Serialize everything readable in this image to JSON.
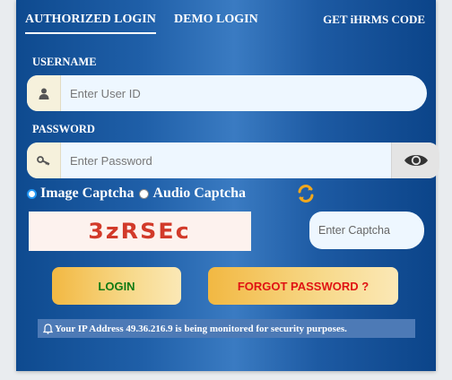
{
  "tabs": {
    "authorized": "AUTHORIZED LOGIN",
    "demo": "DEMO LOGIN",
    "code": "GET iHRMS CODE"
  },
  "username": {
    "label": "USERNAME",
    "placeholder": "Enter User ID",
    "icon": "user-icon"
  },
  "password": {
    "label": "PASSWORD",
    "placeholder": "Enter Password",
    "icon": "key-icon",
    "toggle_icon": "eye-icon"
  },
  "captcha": {
    "options": [
      "Image Captcha",
      "Audio Captcha"
    ],
    "selected": "Image Captcha",
    "text": "3zRSEc",
    "placeholder": "Enter Captcha",
    "refresh_icon": "refresh-icon"
  },
  "buttons": {
    "login": "LOGIN",
    "forgot": "FORGOT PASSWORD ?"
  },
  "notice": {
    "text": "Your IP Address 49.36.216.9 is being monitored for security purposes.",
    "icon": "bell-icon"
  },
  "colors": {
    "panel": "#1f5fa8",
    "login_text": "#0f7a14",
    "forgot_text": "#e01313",
    "captcha_text": "#d23a2a",
    "button_gold": "#f2b842"
  }
}
